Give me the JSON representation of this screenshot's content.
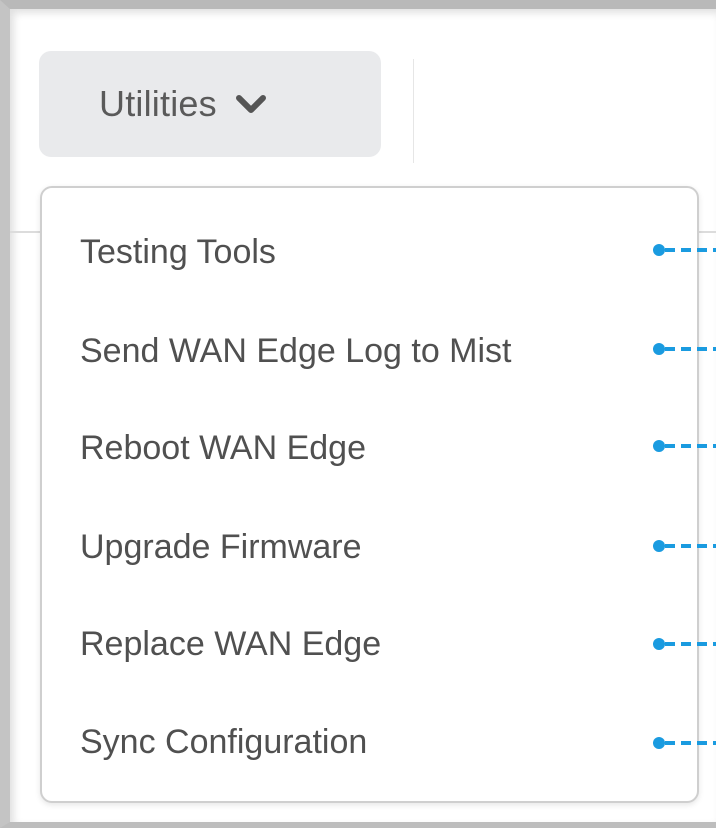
{
  "toolbar": {
    "utilities_label": "Utilities",
    "utilities_icon": "chevron-down-icon"
  },
  "menu": {
    "items": [
      {
        "label": "Testing Tools"
      },
      {
        "label": "Send WAN Edge Log to Mist"
      },
      {
        "label": "Reboot WAN Edge"
      },
      {
        "label": "Upgrade Firmware"
      },
      {
        "label": "Replace WAN Edge"
      },
      {
        "label": "Sync Configuration"
      }
    ]
  },
  "colors": {
    "callout": "#1a9be0",
    "button_bg": "#e9eaec",
    "text": "#505050"
  }
}
